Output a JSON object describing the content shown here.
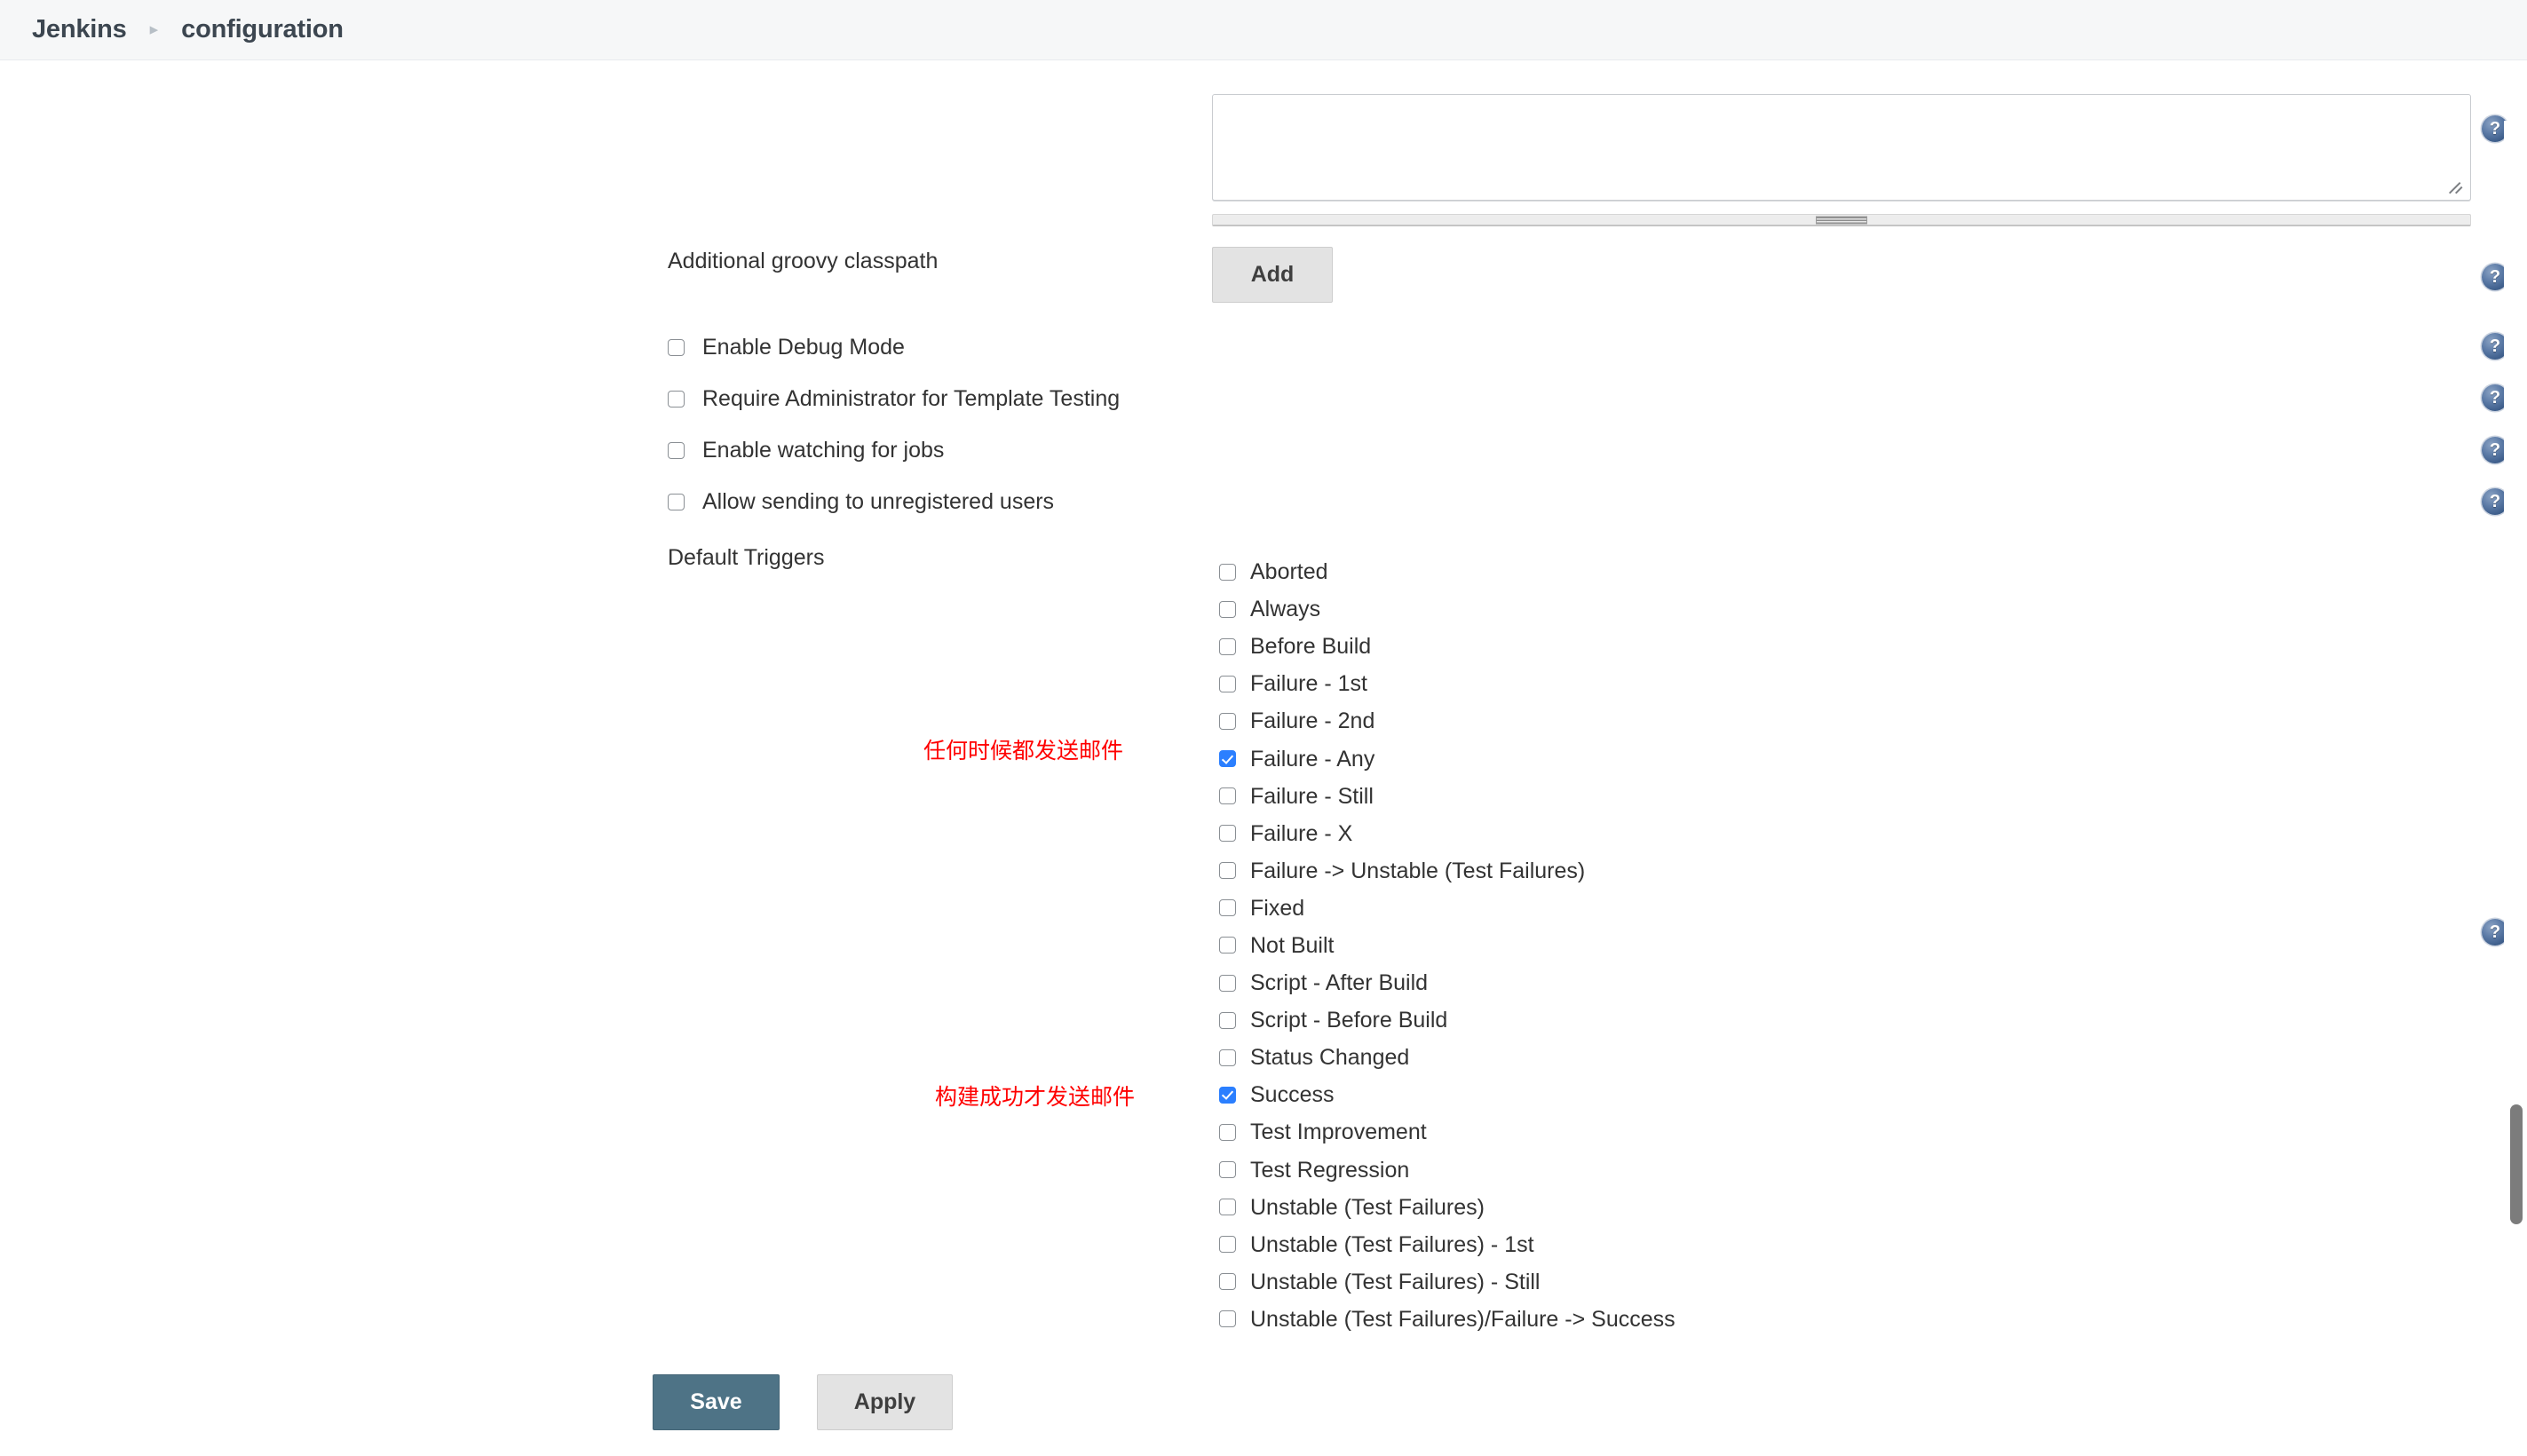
{
  "header": {
    "breadcrumb": [
      {
        "label": "Jenkins"
      },
      {
        "label": "configuration"
      }
    ],
    "separator": "▸"
  },
  "form": {
    "groovy_classpath": {
      "label": "Additional groovy classpath",
      "textarea_value": "",
      "add_button": "Add"
    },
    "settings": [
      {
        "label": "Enable Debug Mode",
        "checked": false
      },
      {
        "label": "Require Administrator for Template Testing",
        "checked": false
      },
      {
        "label": "Enable watching for jobs",
        "checked": false
      },
      {
        "label": "Allow sending to unregistered users",
        "checked": false
      }
    ],
    "default_triggers": {
      "label": "Default Triggers",
      "options": [
        {
          "label": "Aborted",
          "checked": false
        },
        {
          "label": "Always",
          "checked": false
        },
        {
          "label": "Before Build",
          "checked": false
        },
        {
          "label": "Failure - 1st",
          "checked": false
        },
        {
          "label": "Failure - 2nd",
          "checked": false
        },
        {
          "label": "Failure - Any",
          "checked": true
        },
        {
          "label": "Failure - Still",
          "checked": false
        },
        {
          "label": "Failure - X",
          "checked": false
        },
        {
          "label": "Failure -> Unstable (Test Failures)",
          "checked": false
        },
        {
          "label": "Fixed",
          "checked": false
        },
        {
          "label": "Not Built",
          "checked": false
        },
        {
          "label": "Script - After Build",
          "checked": false
        },
        {
          "label": "Script - Before Build",
          "checked": false
        },
        {
          "label": "Status Changed",
          "checked": false
        },
        {
          "label": "Success",
          "checked": true
        },
        {
          "label": "Test Improvement",
          "checked": false
        },
        {
          "label": "Test Regression",
          "checked": false
        },
        {
          "label": "Unstable (Test Failures)",
          "checked": false
        },
        {
          "label": "Unstable (Test Failures) - 1st",
          "checked": false
        },
        {
          "label": "Unstable (Test Failures) - Still",
          "checked": false
        },
        {
          "label": "Unstable (Test Failures)/Failure -> Success",
          "checked": false
        }
      ]
    },
    "annotations": [
      {
        "text": "任何时候都发送邮件",
        "color": "#ff0000"
      },
      {
        "text": "构建成功才发送邮件",
        "color": "#ff0000"
      }
    ],
    "actions": {
      "save_label": "Save",
      "apply_label": "Apply"
    }
  },
  "help_icons": {
    "glyph": "?",
    "count": 7
  },
  "colors": {
    "save_button": "#4e7386",
    "checkbox_checked": "#2b7fff",
    "annotation_red": "#ff0000",
    "header_background": "#f6f7f8",
    "breadcrumb_text": "#3c4650"
  }
}
